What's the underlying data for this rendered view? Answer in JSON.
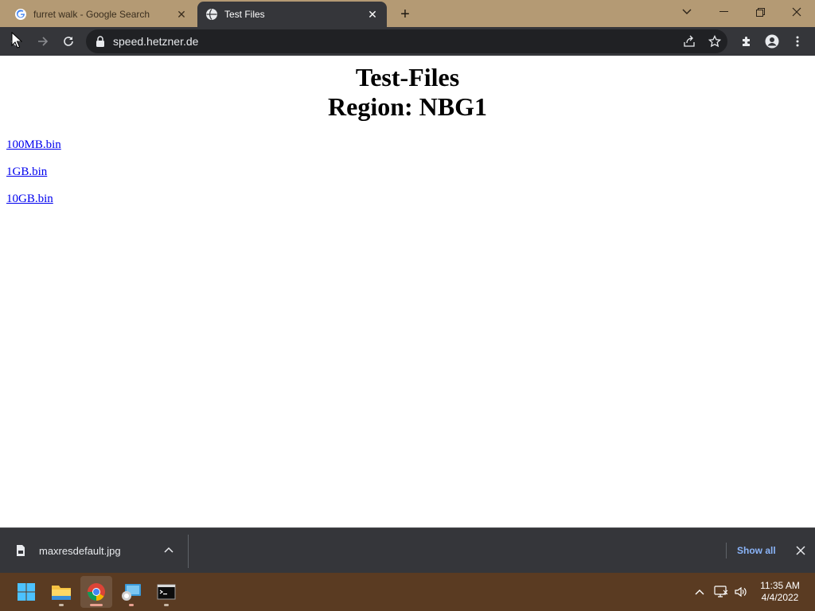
{
  "tabs": [
    {
      "title": "furret walk - Google Search",
      "favicon": "google-icon",
      "active": false
    },
    {
      "title": "Test Files",
      "favicon": "globe-icon",
      "active": true
    }
  ],
  "address_bar": {
    "url": "speed.hetzner.de"
  },
  "page": {
    "heading_line1": "Test-Files",
    "heading_line2": "Region: NBG1",
    "links": [
      "100MB.bin",
      "1GB.bin",
      "10GB.bin"
    ]
  },
  "download_bar": {
    "filename": "maxresdefault.jpg",
    "show_all_label": "Show all"
  },
  "taskbar": {
    "time": "11:35 AM",
    "date": "4/4/2022"
  },
  "colors": {
    "tab_strip": "#b49a74",
    "toolbar": "#35363a",
    "link": "#0000ee",
    "taskbar": "#5a3b22",
    "show_all": "#8ab4f8"
  }
}
